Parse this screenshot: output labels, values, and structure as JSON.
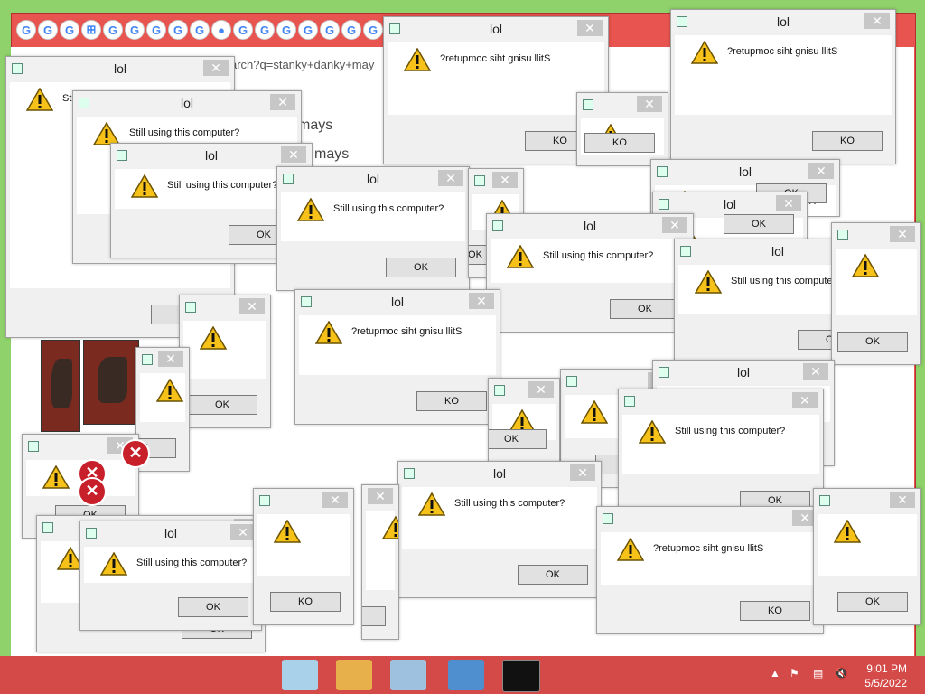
{
  "browser": {
    "tab_glyphs": [
      "G",
      "G",
      "G",
      "⊞",
      "G",
      "G",
      "G",
      "G",
      "G",
      "●",
      "G",
      "G",
      "G",
      "G",
      "G",
      "G",
      "G",
      "G"
    ],
    "url_fragment": "arch?q=stanky+danky+may",
    "bg_text_1": "mays",
    "bg_text_2": "mays"
  },
  "dialogs": [
    {
      "title": "lol",
      "message": "Still using this computer?",
      "button": "OK"
    },
    {
      "title": "lol",
      "message": "?retupmoc siht gnisu llitS",
      "button": "KO"
    }
  ],
  "taskbar": {
    "time": "9:01 PM",
    "date": "5/5/2022",
    "icons": [
      "recycle-bin-icon",
      "paint-icon",
      "task-manager-icon",
      "registry-icon",
      "cmd-icon"
    ]
  },
  "colors": {
    "browser_frame": "#e8544f",
    "desktop": "#8fd16a",
    "taskbar": "#d44a48"
  }
}
